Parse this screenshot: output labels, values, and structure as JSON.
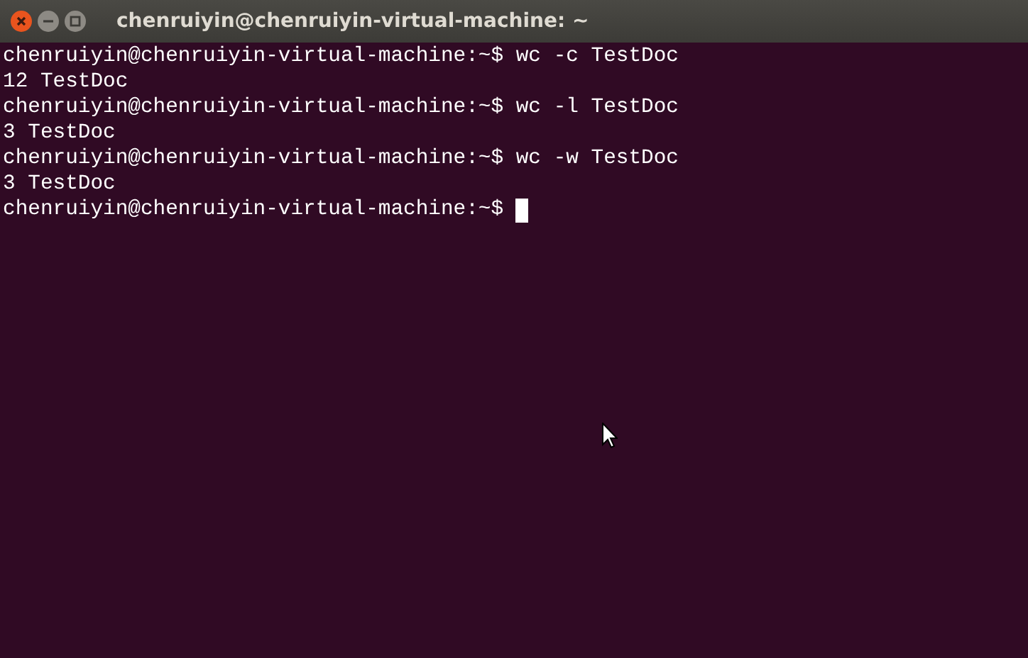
{
  "window": {
    "title": "chenruiyin@chenruiyin-virtual-machine: ~"
  },
  "terminal": {
    "lines": [
      {
        "text": "chenruiyin@chenruiyin-virtual-machine:~$ wc -c TestDoc",
        "cursor": false
      },
      {
        "text": "12 TestDoc",
        "cursor": false
      },
      {
        "text": "chenruiyin@chenruiyin-virtual-machine:~$ wc -l TestDoc",
        "cursor": false
      },
      {
        "text": "3 TestDoc",
        "cursor": false
      },
      {
        "text": "chenruiyin@chenruiyin-virtual-machine:~$ wc -w TestDoc",
        "cursor": false
      },
      {
        "text": "3 TestDoc",
        "cursor": false
      },
      {
        "text": "chenruiyin@chenruiyin-virtual-machine:~$ ",
        "cursor": true
      }
    ]
  }
}
